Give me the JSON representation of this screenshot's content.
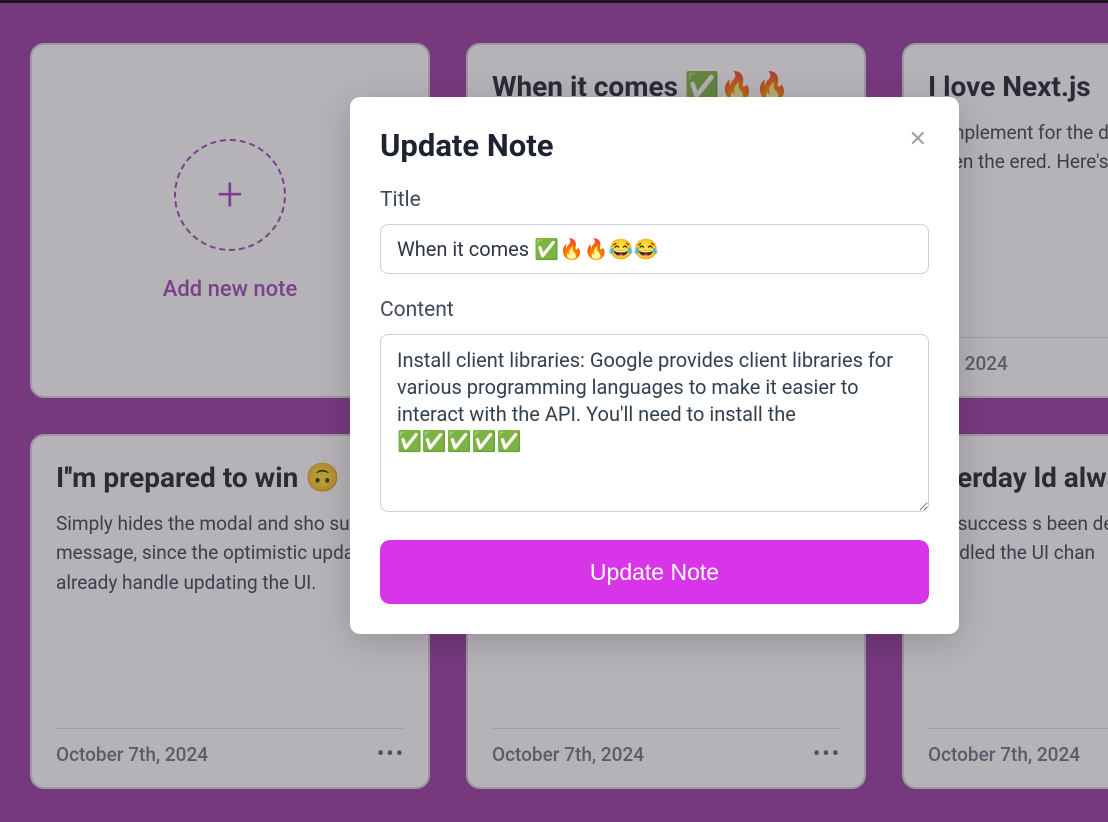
{
  "add_new": {
    "label": "Add new note"
  },
  "cards": [
    {
      "title": "When it comes ✅🔥🔥",
      "body": "",
      "date": ""
    },
    {
      "title": "I love Next.js",
      "body": "n implement for the delet ately removi he when the ered. Here's your deleteN",
      "date": "7th, 2024"
    },
    {
      "title": "I''m prepared to win 🙃",
      "body": "Simply hides the modal and sho success message, since the optimistic update already handle updating the UI.",
      "date": "October 7th, 2024"
    },
    {
      "title": "",
      "body": "",
      "date": "October 7th, 2024"
    },
    {
      "title": " everday ld always",
      "body": "s a success s been delet tic update ha handled the UI chan",
      "date": "October 7th, 2024"
    }
  ],
  "modal": {
    "heading": "Update Note",
    "title_label": "Title",
    "title_value": "When it comes ✅🔥🔥😂😂",
    "content_label": "Content",
    "content_value": "Install client libraries: Google provides client libraries for various programming languages to make it easier to interact with the API. You'll need to install the ✅✅✅✅✅",
    "submit_label": "Update Note",
    "close_glyph": "✕"
  }
}
